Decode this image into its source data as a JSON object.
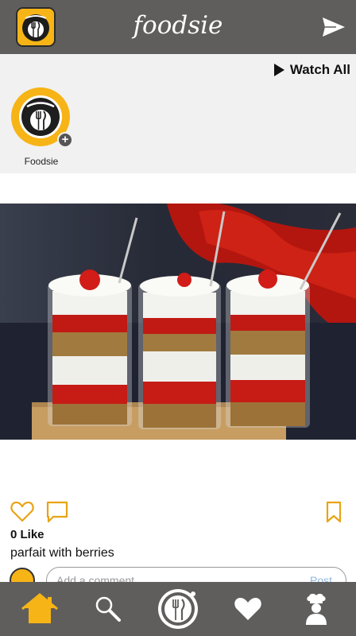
{
  "header": {
    "title": "foodsie",
    "logo_icon": "foodsie-app-logo",
    "send_icon": "send-icon"
  },
  "stories": {
    "watch_all_label": "Watch All",
    "items": [
      {
        "label": "Foodsie",
        "icon": "foodsie-story-avatar"
      }
    ]
  },
  "post": {
    "likes": "0 Like",
    "caption": "parfait with berries",
    "comment_placeholder": "Add a comment...",
    "post_label": "Post"
  },
  "bottom_nav": {
    "items": [
      {
        "name": "home",
        "icon": "home-icon",
        "active": true
      },
      {
        "name": "search",
        "icon": "search-icon",
        "active": false
      },
      {
        "name": "create",
        "icon": "plate-cutlery-icon",
        "active": false
      },
      {
        "name": "favorites",
        "icon": "heart-icon",
        "active": false
      },
      {
        "name": "profile",
        "icon": "chef-icon",
        "active": false
      }
    ]
  },
  "colors": {
    "bar": "#5f5e5c",
    "accent": "#f7b417",
    "stories_bg": "#f1f1f1",
    "post_link": "#8fb7de"
  }
}
